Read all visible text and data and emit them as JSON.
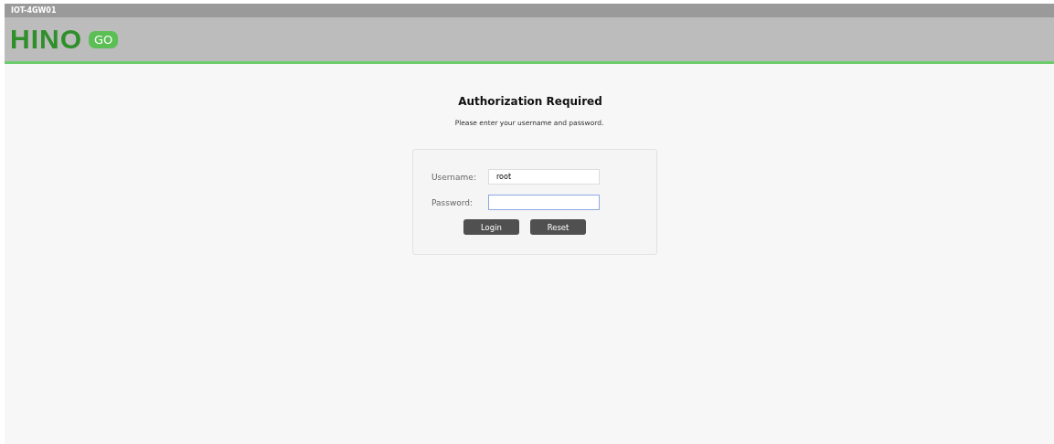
{
  "top_bar": {
    "title": "IOT-4GW01"
  },
  "logo": {
    "text": "HINO",
    "badge": "GO"
  },
  "heading": "Authorization Required",
  "subtitle": "Please enter your username and password.",
  "form": {
    "fields": [
      {
        "label": "Username:",
        "value": "root",
        "focused": false
      },
      {
        "label": "Password:",
        "focused": true
      }
    ],
    "buttons": [
      "Login",
      "Reset"
    ]
  }
}
